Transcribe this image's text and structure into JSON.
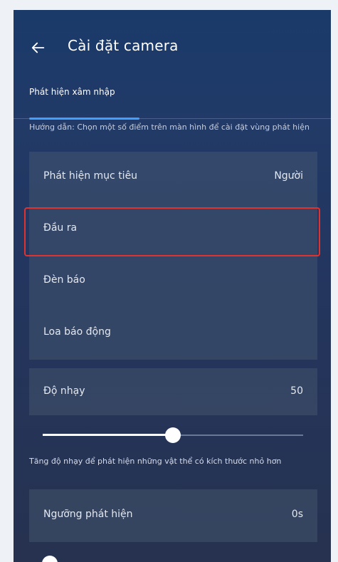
{
  "header": {
    "title": "Cài đặt camera",
    "back_icon": "arrow-left-icon"
  },
  "tab": {
    "label": "Phát hiện xâm nhập"
  },
  "instruction": "Hướng dẫn: Chọn một số điểm trên màn hình để cài đặt vùng phát hiện",
  "detection_settings": {
    "target": {
      "label": "Phát hiện mục tiêu",
      "value": "Người"
    },
    "output": {
      "label": "Đầu ra"
    },
    "light": {
      "label": "Đèn báo"
    },
    "alarm": {
      "label": "Loa báo động"
    }
  },
  "sensitivity": {
    "label": "Độ nhạy",
    "value": "50",
    "fraction": 0.5,
    "hint": "Tăng độ nhạy để phát hiện những vật thể có kích thước nhỏ hơn"
  },
  "threshold": {
    "label": "Ngưỡng phát hiện",
    "value": "0s"
  },
  "colors": {
    "accent": "#41a0ff",
    "highlight": "#e0322e"
  }
}
